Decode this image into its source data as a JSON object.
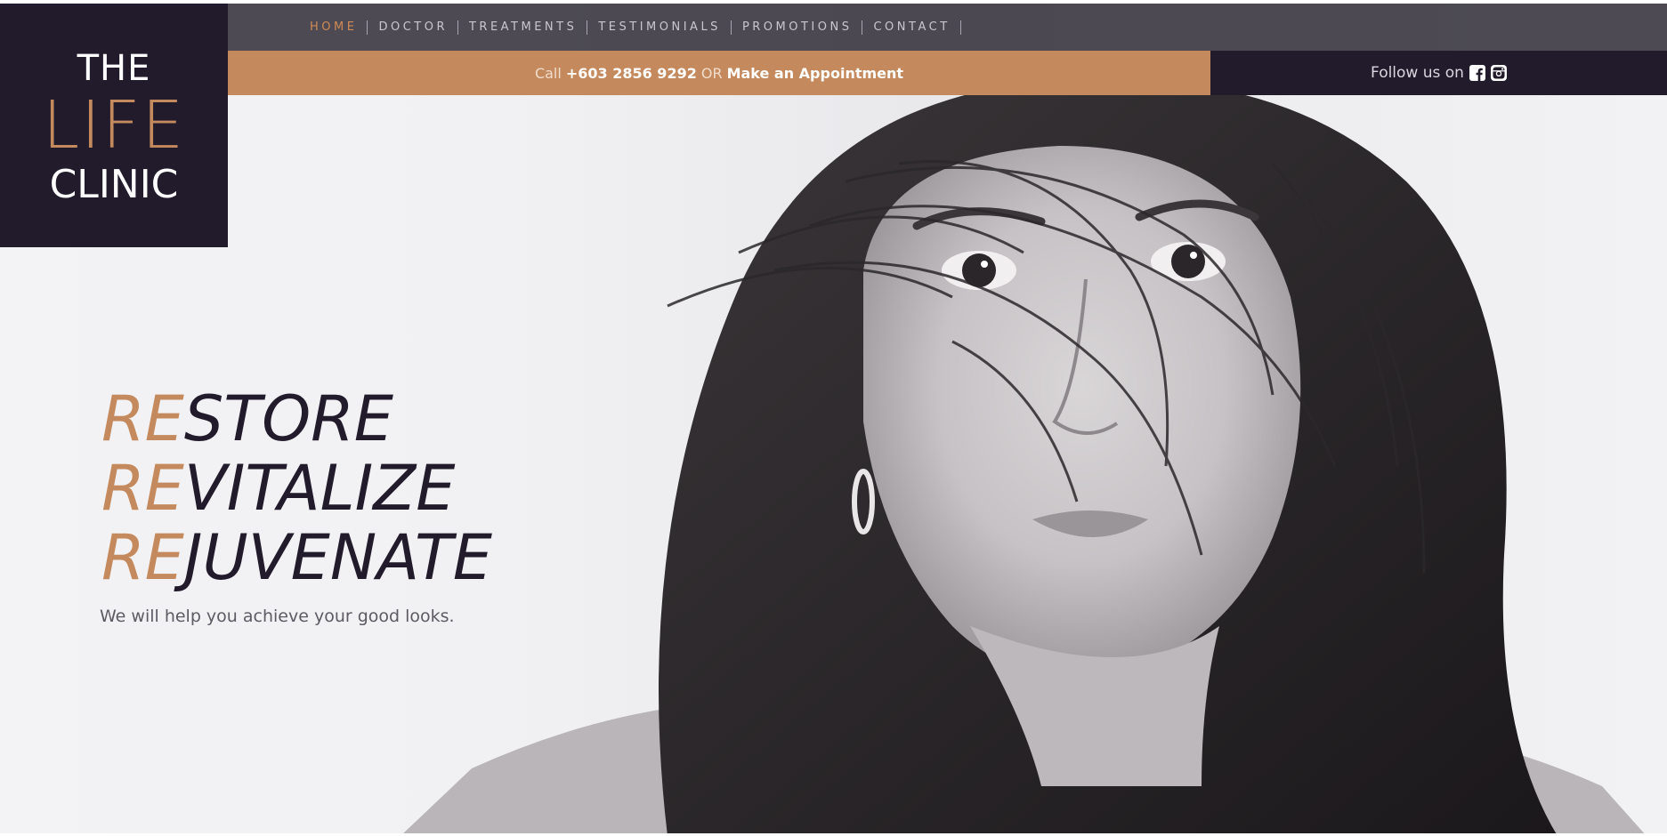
{
  "logo": {
    "line1": "THE",
    "line2": "LIFE",
    "line3": "CLINIC"
  },
  "nav": {
    "items": [
      {
        "label": "HOME",
        "active": true
      },
      {
        "label": "DOCTOR",
        "active": false
      },
      {
        "label": "TREATMENTS",
        "active": false
      },
      {
        "label": "TESTIMONIALS",
        "active": false
      },
      {
        "label": "PROMOTIONS",
        "active": false
      },
      {
        "label": "CONTACT",
        "active": false
      }
    ]
  },
  "callbar": {
    "call_prefix": "Call",
    "phone": "+603 2856 9292",
    "or_text": "OR",
    "appointment_label": "Make an Appointment"
  },
  "follow": {
    "label": "Follow us on",
    "icons": [
      "facebook-icon",
      "instagram-icon"
    ]
  },
  "hero": {
    "lines": [
      {
        "prefix": "RE",
        "rest": "STORE"
      },
      {
        "prefix": "RE",
        "rest": "VITALIZE"
      },
      {
        "prefix": "RE",
        "rest": "JUVENATE"
      }
    ],
    "tagline": "We will help you achieve your good looks."
  },
  "colors": {
    "accent": "#c48a5d",
    "dark": "#221b2c",
    "nav_active": "#d08a54"
  }
}
